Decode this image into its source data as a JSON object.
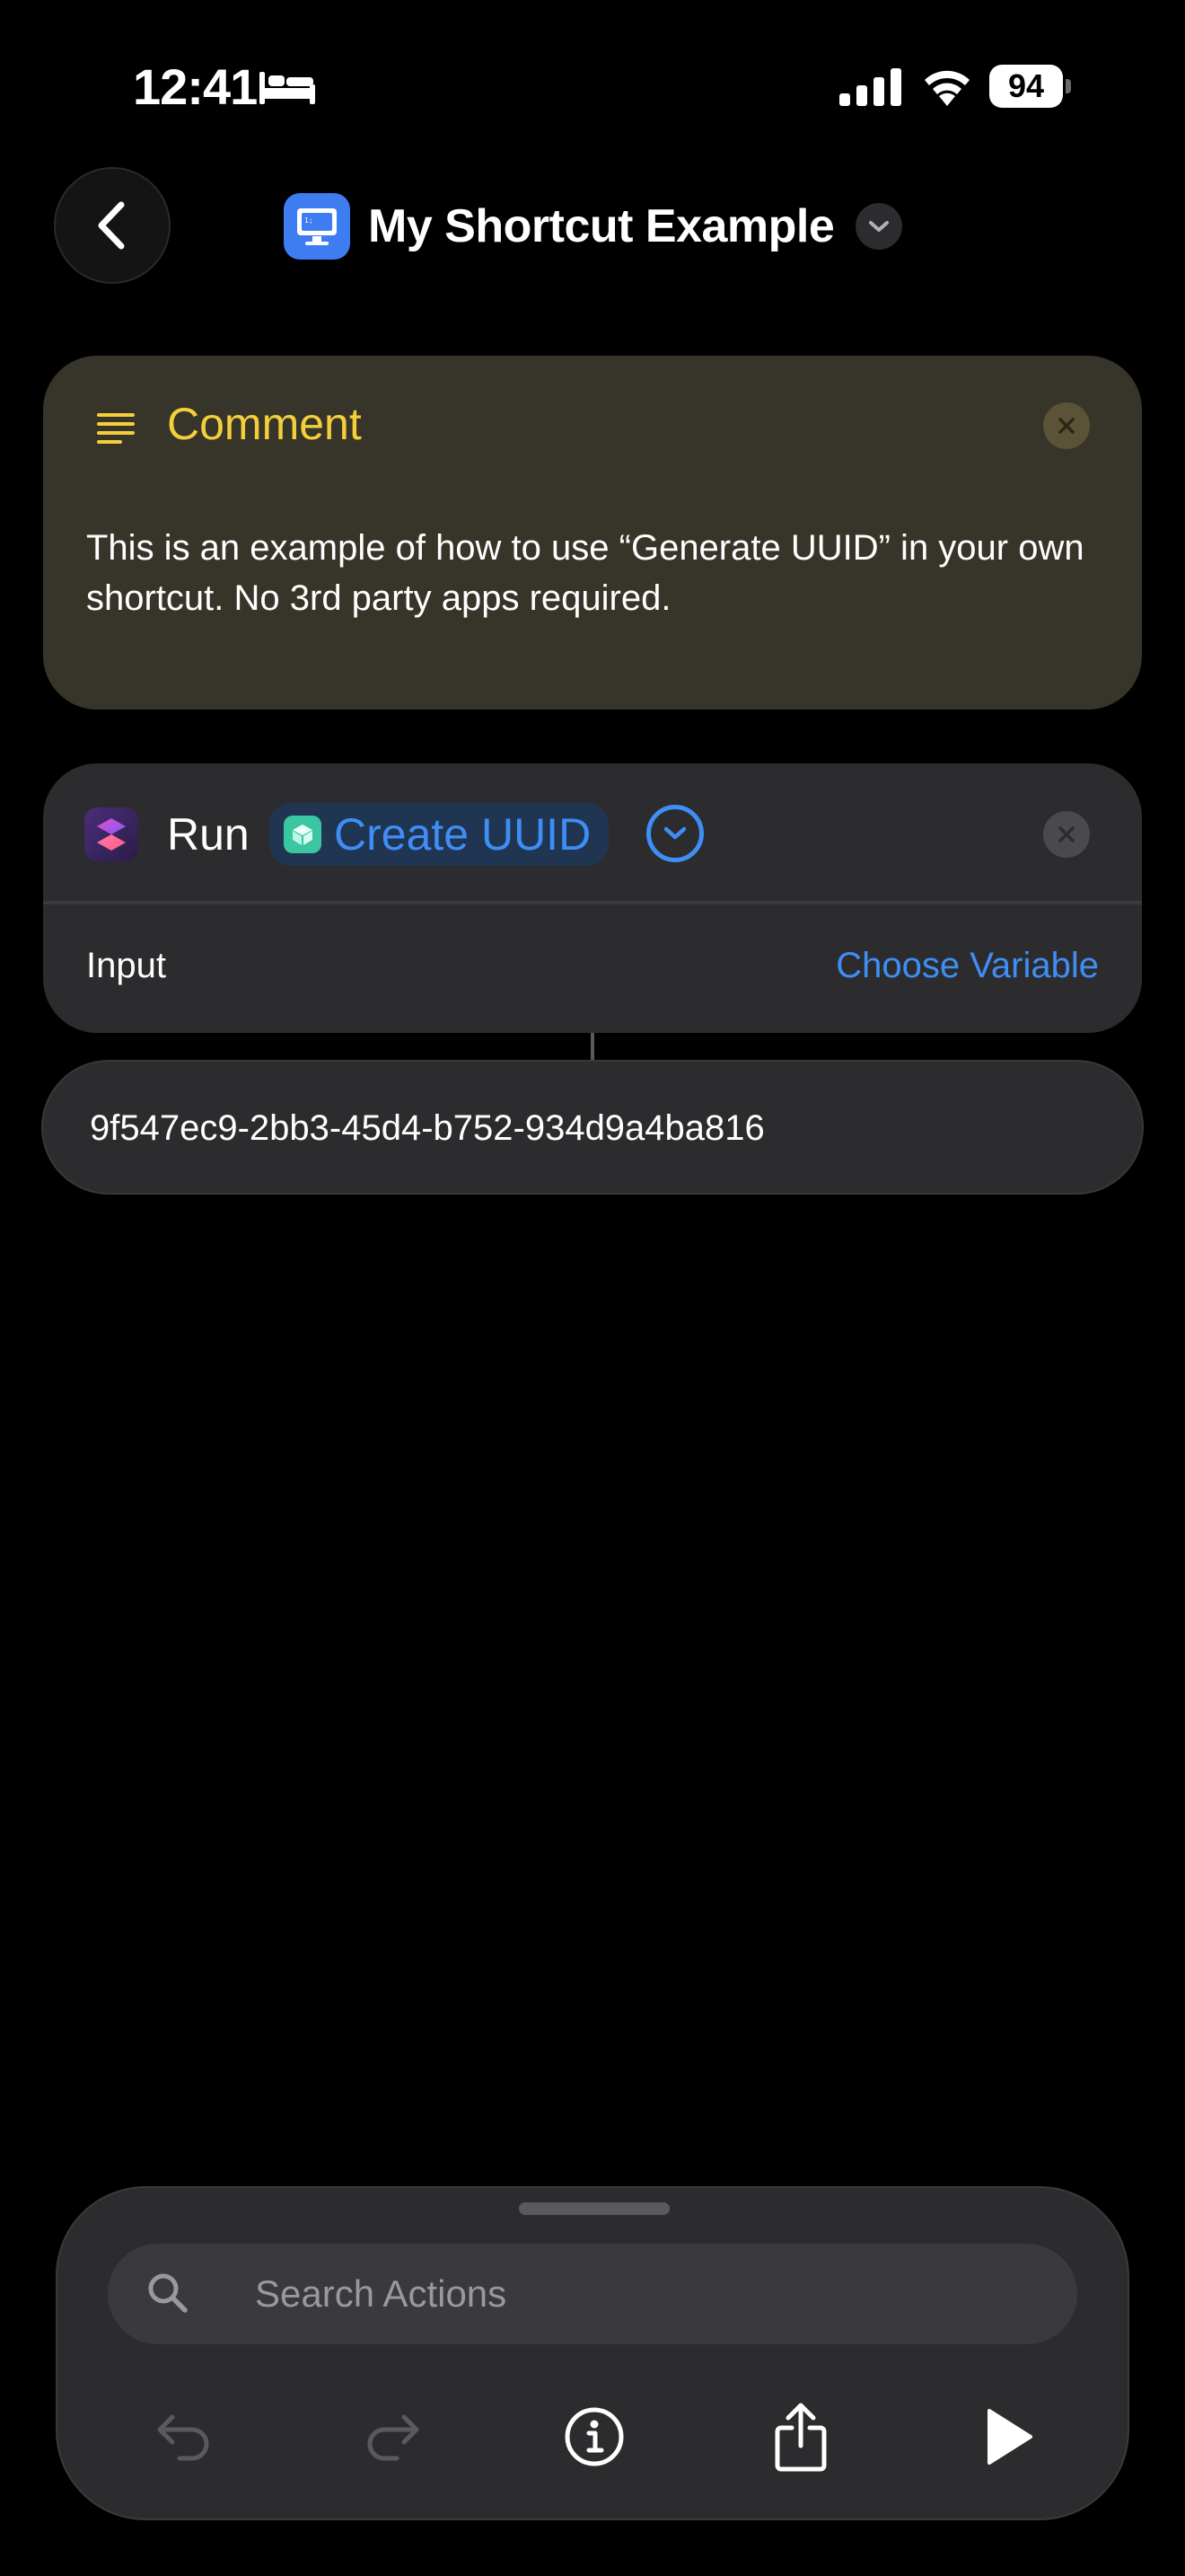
{
  "status_bar": {
    "time": "12:41",
    "battery": "94",
    "icons": [
      "sleep-icon",
      "cellular-signal-icon",
      "wifi-icon",
      "battery-icon"
    ]
  },
  "header": {
    "back_icon": "chevron-left-icon",
    "app_icon": "monitor-icon",
    "title": "My Shortcut Example",
    "title_chevron_icon": "chevron-down-icon"
  },
  "comment": {
    "icon": "text-lines-icon",
    "title": "Comment",
    "body": "This is an example of how to use “Generate UUID” in your own shortcut. No 3rd party apps required.",
    "close_icon": "close-icon",
    "accent_color": "#f4cf3a"
  },
  "run_action": {
    "icon": "shortcuts-icon",
    "label": "Run",
    "parameter": "Create UUID",
    "parameter_icon": "cube-icon",
    "expand_icon": "chevron-down-circle-icon",
    "close_icon": "close-icon",
    "input_label": "Input",
    "input_value": "Choose Variable",
    "accent_color": "#3f8ef5"
  },
  "output": {
    "value": "9f547ec9-2bb3-45d4-b752-934d9a4ba816"
  },
  "action_sheet": {
    "search_placeholder": "Search Actions",
    "toolbar": [
      {
        "name": "undo",
        "icon": "undo-icon",
        "enabled": false
      },
      {
        "name": "redo",
        "icon": "redo-icon",
        "enabled": false
      },
      {
        "name": "info",
        "icon": "info-icon",
        "enabled": true
      },
      {
        "name": "share",
        "icon": "share-icon",
        "enabled": true
      },
      {
        "name": "play",
        "icon": "play-icon",
        "enabled": true
      }
    ]
  }
}
